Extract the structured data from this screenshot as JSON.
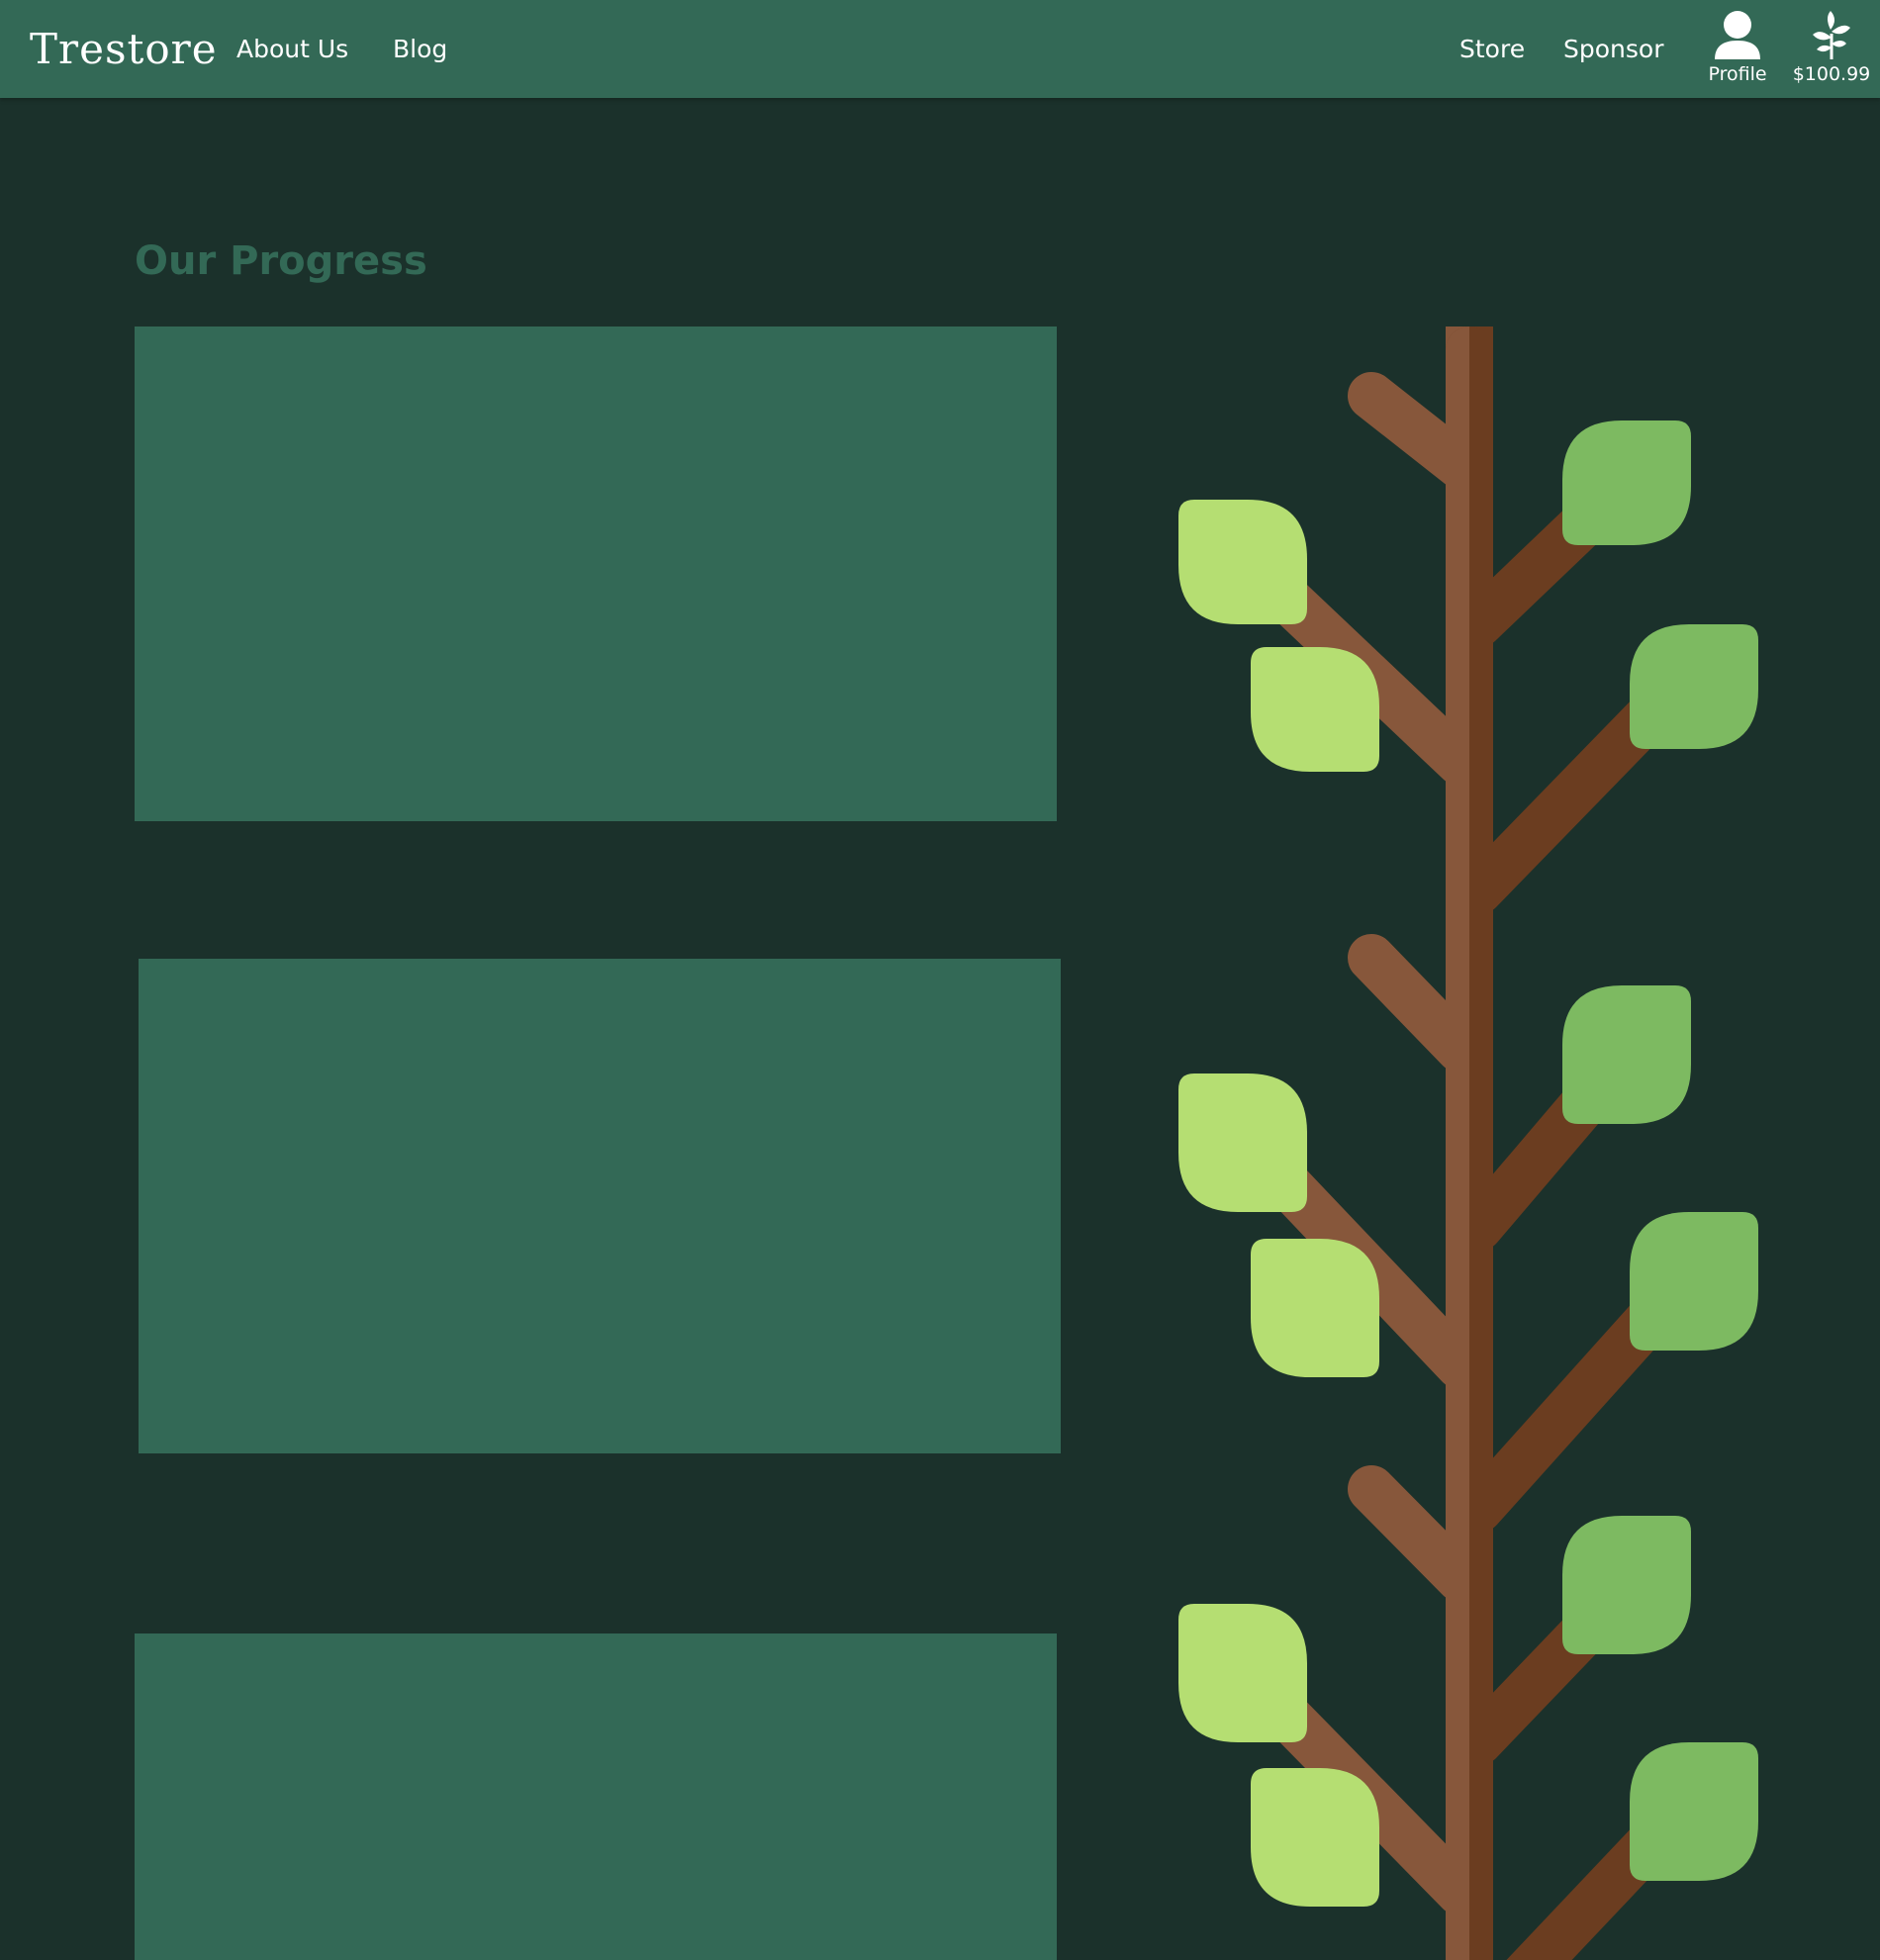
{
  "colors": {
    "page_background": "#1b312b",
    "header_background": "#336956",
    "card_background": "#336956",
    "title_color": "#336956",
    "trunk_light": "#87573b",
    "trunk_dark": "#6b3d20",
    "leaf_light": "#b5de72",
    "leaf_dark": "#7dba61"
  },
  "header": {
    "logo": "Trestore",
    "nav": {
      "about": "About Us",
      "blog": "Blog",
      "store": "Store",
      "sponsor": "Sponsor"
    },
    "profile": {
      "icon": "person-icon",
      "label": "Profile"
    },
    "balance": {
      "icon": "sprout-icon",
      "amount": "$100.99"
    }
  },
  "main": {
    "title": "Our Progress",
    "cards": [
      {
        "name": "progress-card-1"
      },
      {
        "name": "progress-card-2"
      },
      {
        "name": "progress-card-3"
      }
    ],
    "tree": {
      "icon": "progress-tree-illustration"
    }
  }
}
